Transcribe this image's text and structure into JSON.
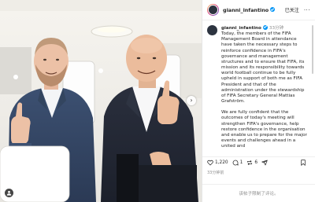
{
  "post": {
    "username": "gianni_infantino",
    "follow_label": "已关注",
    "more_label": "···",
    "time_ago": "33分钟",
    "caption_paragraphs": [
      "Today, the members of the FIFA Management Board in attendance have taken the necessary steps to reinforce confidence in FIFA's governance and management structures and to ensure that FIFA, its mission and its responsibility towards world football continue to be fully upheld in support of both me as FIFA President and that of the administration under the stewardship of FIFA Secretary General Mattias Grafström.",
      "We are fully confident that the outcomes of today's meeting will strengthen FIFA's governance, help restore confidence in the organisation and enable us to prepare for the major events and challenges ahead in a united and"
    ],
    "likes": "1,220",
    "comments": "1",
    "shares": "6",
    "timestamp": "33分钟前",
    "comment_placeholder": "该帖子限制了评论。"
  },
  "icons": {
    "heart": "heart-icon",
    "comment": "comment-icon",
    "repost": "repost-icon",
    "share": "share-icon",
    "save": "bookmark-icon",
    "next": "chevron-right-icon",
    "tag": "person-tag-icon",
    "verified": "verified-badge-icon"
  },
  "colors": {
    "verified_blue": "#0095f6",
    "text": "#262626",
    "muted": "#8e8e8e"
  }
}
